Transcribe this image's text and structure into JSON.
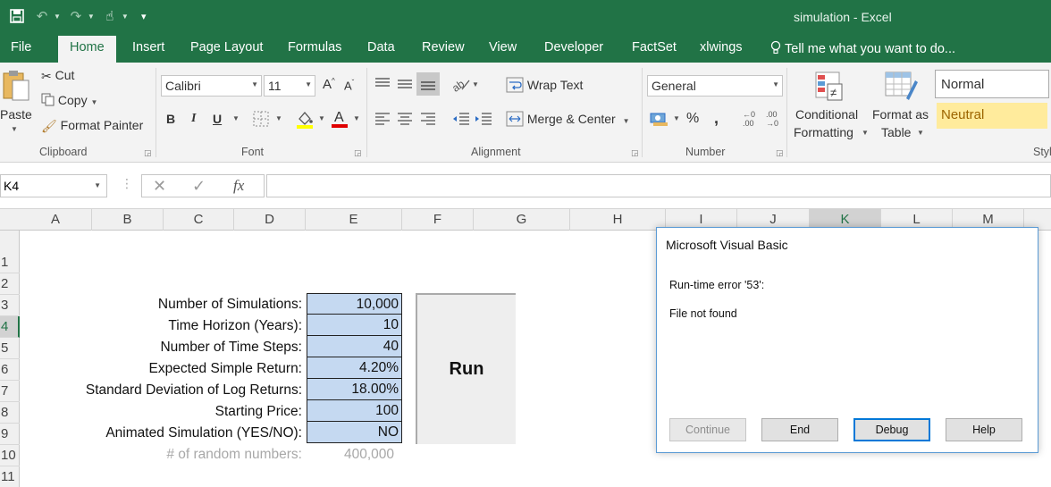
{
  "window": {
    "title": "simulation - Excel"
  },
  "tabs": [
    "File",
    "Home",
    "Insert",
    "Page Layout",
    "Formulas",
    "Data",
    "Review",
    "View",
    "Developer",
    "FactSet",
    "xlwings"
  ],
  "tell_me": "Tell me what you want to do...",
  "ribbon": {
    "clipboard": {
      "label": "Clipboard",
      "paste": "Paste",
      "cut": "Cut",
      "copy": "Copy",
      "format_painter": "Format Painter"
    },
    "font": {
      "label": "Font",
      "name": "Calibri",
      "size": "11",
      "bold": "B",
      "italic": "I",
      "underline": "U"
    },
    "alignment": {
      "label": "Alignment",
      "wrap_text": "Wrap Text",
      "merge_center": "Merge & Center"
    },
    "number": {
      "label": "Number",
      "format": "General",
      "percent": "%",
      "comma": ","
    },
    "styles": {
      "label": "Styl",
      "conditional_1": "Conditional",
      "conditional_2": "Formatting",
      "format_table_1": "Format as",
      "format_table_2": "Table",
      "normal": "Normal",
      "neutral": "Neutral"
    }
  },
  "formula_bar": {
    "name_box": "K4",
    "content": ""
  },
  "columns": [
    "A",
    "B",
    "C",
    "D",
    "E",
    "F",
    "G",
    "H",
    "I",
    "J",
    "K",
    "L",
    "M"
  ],
  "selected_column": "K",
  "rows": [
    "1",
    "2",
    "3",
    "4",
    "5",
    "6",
    "7",
    "8",
    "9",
    "10",
    "11"
  ],
  "selected_row": "4",
  "sheet": {
    "labels": [
      "Number of Simulations:",
      "Time Horizon (Years):",
      "Number of Time Steps:",
      "Expected Simple Return:",
      "Standard Deviation of Log Returns:",
      "Starting Price:",
      "Animated Simulation (YES/NO):"
    ],
    "values": [
      "10,000",
      "10",
      "40",
      "4.20%",
      "18.00%",
      "100",
      "NO"
    ],
    "calc_label": "# of random numbers:",
    "calc_value": "400,000",
    "run_button": "Run"
  },
  "dialog": {
    "title": "Microsoft Visual Basic",
    "error": "Run-time error '53':",
    "message": "File not found",
    "buttons": {
      "continue": "Continue",
      "end": "End",
      "debug": "Debug",
      "help": "Help"
    }
  },
  "colors": {
    "excel_green": "#217346",
    "input_fill": "#c5d9f1",
    "neutral_fill": "#ffeb9c",
    "dialog_border": "#5b9bd5"
  }
}
